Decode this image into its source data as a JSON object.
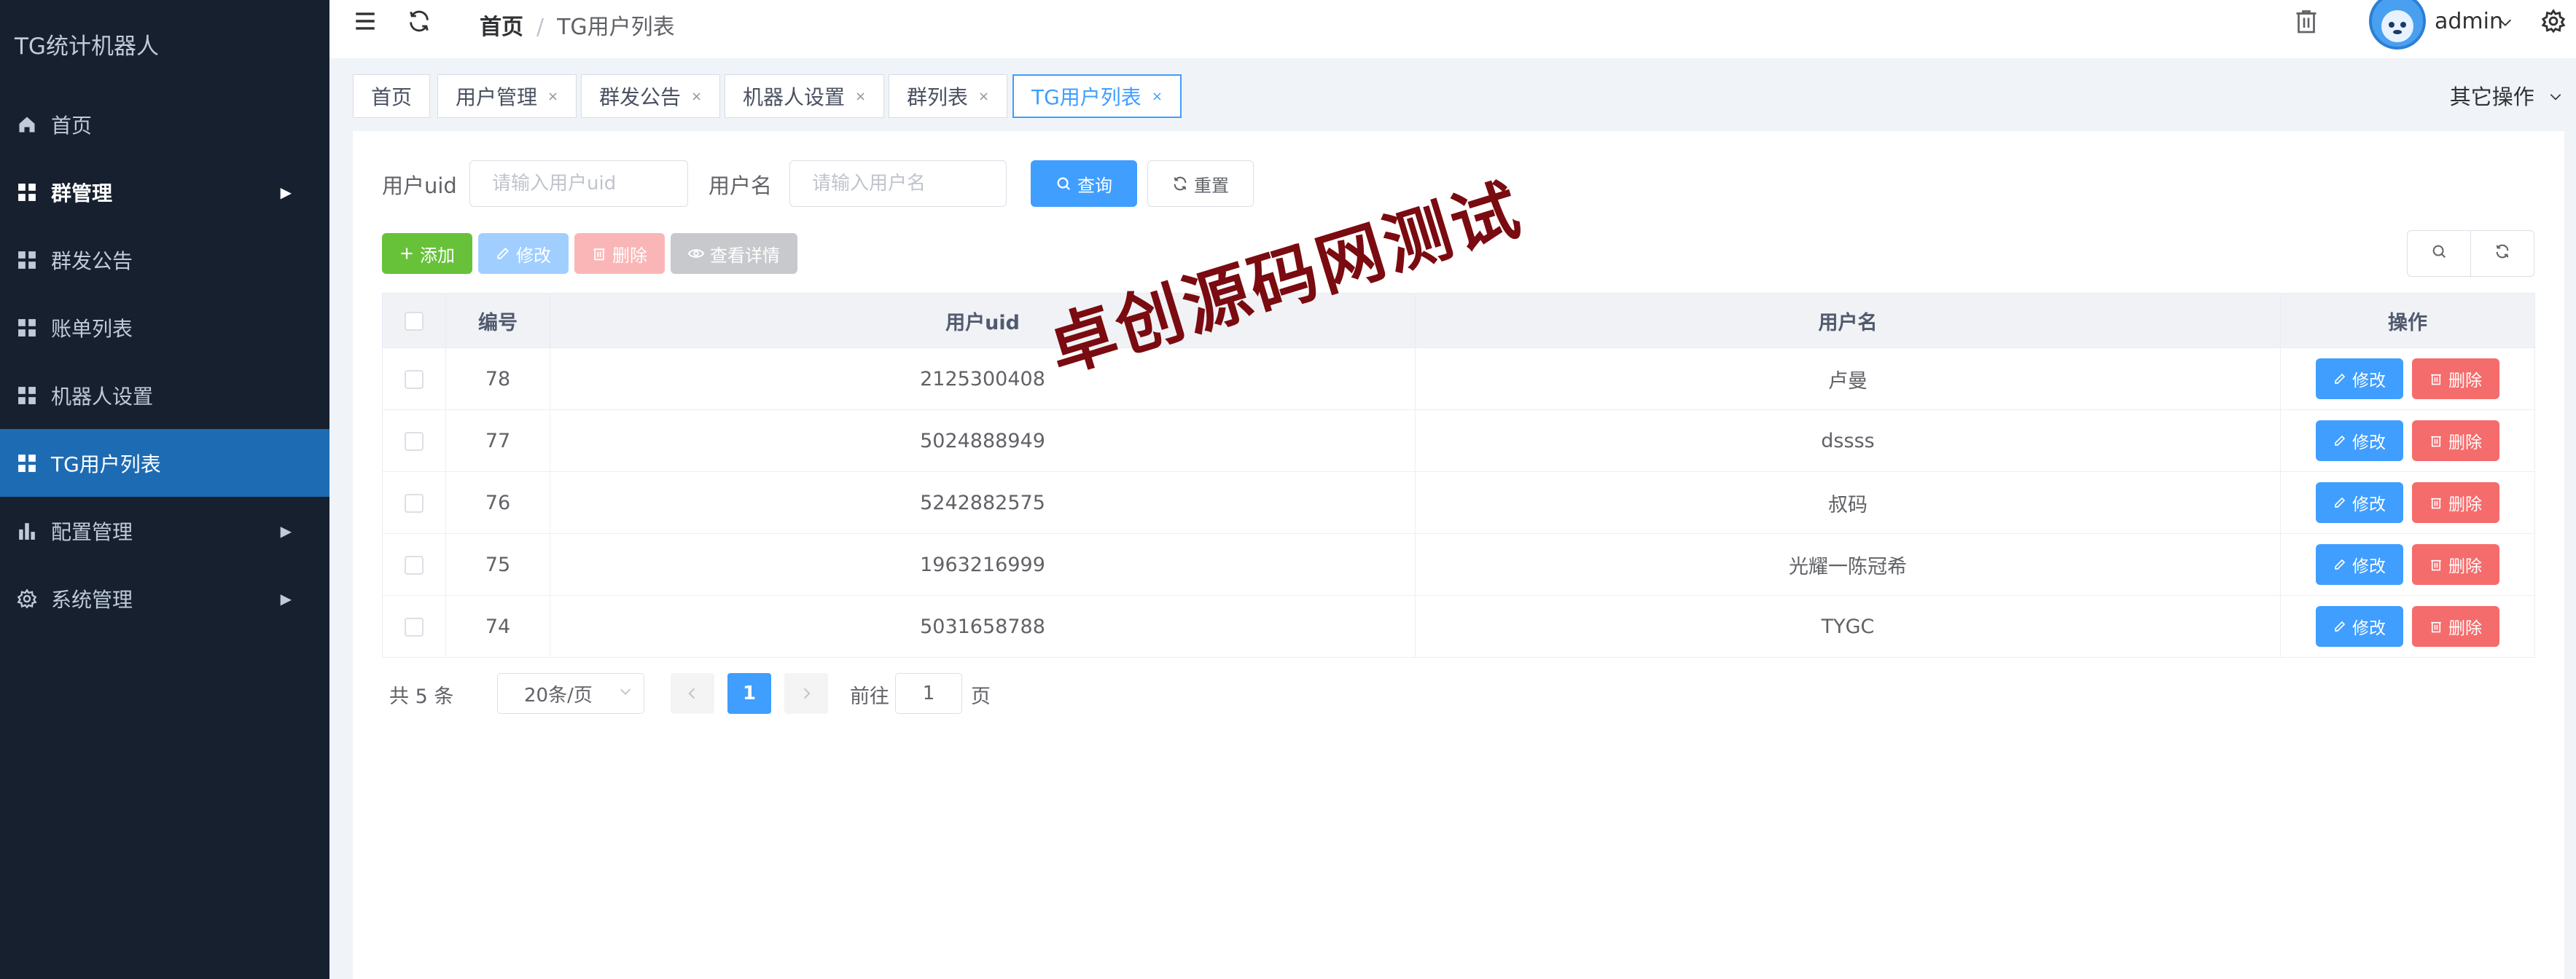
{
  "app": {
    "title": "TG统计机器人"
  },
  "sidebar": {
    "items": [
      {
        "label": "首页",
        "icon": "home-icon"
      },
      {
        "label": "群管理",
        "icon": "grid-icon",
        "has_arrow": true
      },
      {
        "label": "群发公告",
        "icon": "grid-icon"
      },
      {
        "label": "账单列表",
        "icon": "grid-icon"
      },
      {
        "label": "机器人设置",
        "icon": "grid-icon"
      },
      {
        "label": "TG用户列表",
        "icon": "grid-icon",
        "active": true
      },
      {
        "label": "配置管理",
        "icon": "bar-chart-icon",
        "has_arrow": true
      },
      {
        "label": "系统管理",
        "icon": "gear-icon",
        "has_arrow": true
      }
    ]
  },
  "header": {
    "breadcrumb": {
      "home": "首页",
      "separator": "/",
      "current": "TG用户列表"
    },
    "user": "admin"
  },
  "tags": {
    "items": [
      {
        "label": "首页"
      },
      {
        "label": "用户管理",
        "close": "×"
      },
      {
        "label": "群发公告",
        "close": "×"
      },
      {
        "label": "机器人设置",
        "close": "×"
      },
      {
        "label": "群列表",
        "close": "×"
      },
      {
        "label": "TG用户列表",
        "close": "×",
        "active": true
      }
    ],
    "other_ops": "其它操作"
  },
  "search": {
    "uid_label": "用户uid",
    "uid_placeholder": "请输入用户uid",
    "name_label": "用户名",
    "name_placeholder": "请输入用户名",
    "query_label": "查询",
    "reset_label": "重置"
  },
  "toolbar": {
    "add_label": "添加",
    "edit_label": "修改",
    "delete_label": "删除",
    "view_label": "查看详情"
  },
  "table": {
    "columns": [
      "编号",
      "用户uid",
      "用户名",
      "操作"
    ],
    "rows": [
      {
        "id": "78",
        "uid": "2125300408",
        "name": "卢曼"
      },
      {
        "id": "77",
        "uid": "5024888949",
        "name": "dssss"
      },
      {
        "id": "76",
        "uid": "5242882575",
        "name": "叔码"
      },
      {
        "id": "75",
        "uid": "1963216999",
        "name": "光耀一陈冠希"
      },
      {
        "id": "74",
        "uid": "5031658788",
        "name": "TYGC"
      }
    ],
    "row_edit_label": "修改",
    "row_delete_label": "删除"
  },
  "pagination": {
    "total_text": "共 5 条",
    "page_size": "20条/页",
    "current_page": "1",
    "goto_prefix": "前往",
    "goto_value": "1",
    "goto_suffix": "页"
  },
  "watermark": "卓创源码网测试",
  "colors": {
    "sidebar_bg": "#17202e",
    "sidebar_active": "#1d6bb3",
    "primary": "#409eff",
    "success": "#67c23a",
    "danger": "#f56c6c",
    "watermark": "#7a0b10"
  }
}
